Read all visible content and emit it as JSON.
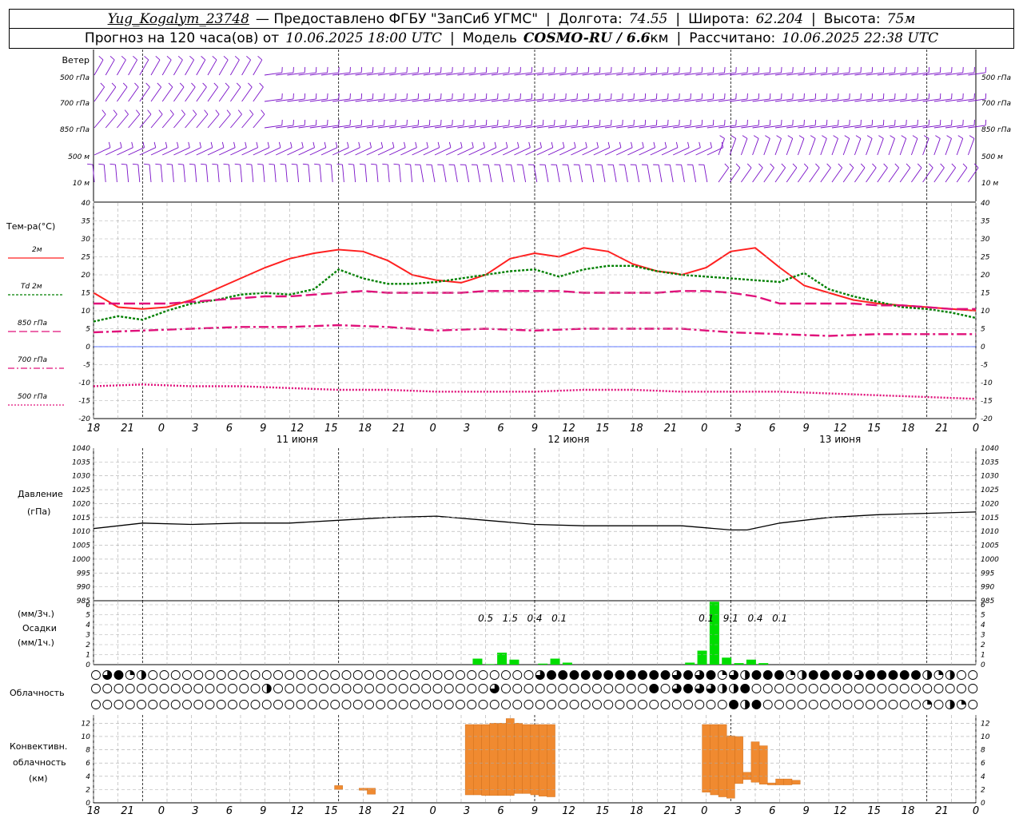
{
  "header": {
    "station": "Yug_Kogalym_23748",
    "provider": "— Предоставлено ФГБУ \"ЗапСиб УГМС\"",
    "lon_label": "Долгота:",
    "lon": "74.55",
    "lat_label": "Широта:",
    "lat": "62.204",
    "alt_label": "Высота:",
    "alt": "75м",
    "forecast_label": "Прогноз на 120 часа(ов) от",
    "forecast_from": "10.06.2025 18:00 UTC",
    "model_label": "Модель",
    "model": "COSMO-RU / 6.6",
    "model_unit": "км",
    "calc_label": "Рассчитано:",
    "calc_time": "10.06.2025 22:38 UTC"
  },
  "panels": {
    "wind": {
      "title": "Ветер",
      "levels": [
        "500 гПа",
        "700 гПа",
        "850 гПа",
        "500 м",
        "10 м"
      ]
    },
    "temp": {
      "title": "Тем-ра(°C)",
      "legend": [
        {
          "label": "2м",
          "color": "#ff2020"
        },
        {
          "label": "Td  2м",
          "color": "#008000"
        },
        {
          "label": "850 гПа",
          "color": "#e0107a"
        },
        {
          "label": "700 гПа",
          "color": "#e0107a"
        },
        {
          "label": "500 гПа",
          "color": "#e0107a"
        }
      ]
    },
    "pressure": {
      "title": "Давление",
      "unit": "(гПа)"
    },
    "precip": {
      "unit1": "(мм/3ч.)",
      "title": "Осадки",
      "unit2": "(мм/1ч.)"
    },
    "cloud": {
      "title": "Облачность"
    },
    "conv": {
      "title": "Конвективн.",
      "title2": "облачность",
      "unit": "(км)"
    }
  },
  "x_axis": {
    "tick_labels": [
      "18",
      "21",
      "0",
      "3",
      "6",
      "9",
      "12",
      "15",
      "18",
      "21",
      "0",
      "3",
      "6",
      "9",
      "12",
      "15",
      "18",
      "21",
      "0",
      "3",
      "6",
      "9",
      "12",
      "15",
      "18",
      "21",
      "0"
    ],
    "day_labels": [
      {
        "label": "11 июня",
        "hour": 18
      },
      {
        "label": "12 июня",
        "hour": 42
      },
      {
        "label": "13 июня",
        "hour": 66
      }
    ]
  },
  "chart_data": [
    {
      "type": "line",
      "title": "Тем-ра(°C)",
      "ylim": [
        -20,
        40
      ],
      "yticks": [
        -20,
        -15,
        -10,
        -5,
        0,
        5,
        10,
        15,
        20,
        25,
        30,
        35,
        40
      ],
      "series": [
        {
          "name": "2м",
          "x": [
            0,
            3,
            6,
            9,
            12,
            15,
            18,
            21,
            24,
            27,
            30,
            33,
            36,
            39,
            42,
            45,
            46,
            48,
            49,
            51,
            54,
            57,
            60,
            63,
            66,
            69,
            71,
            72,
            75,
            78,
            81,
            84,
            87,
            90,
            93,
            96,
            99,
            102,
            105,
            108
          ],
          "values": [
            15,
            11,
            10.5,
            11,
            13,
            16,
            19,
            22,
            24.5,
            26,
            27,
            26.5,
            24,
            20,
            18.5,
            17.8,
            18.5,
            20,
            21.5,
            24.5,
            26,
            25,
            27.5,
            26.5,
            23,
            21,
            20.5,
            20,
            22,
            26.5,
            27.5,
            22,
            17,
            15,
            13,
            12,
            11.5,
            11,
            10.5,
            10
          ]
        },
        {
          "name": "Td  2м",
          "x": [
            0,
            3,
            6,
            9,
            12,
            15,
            18,
            21,
            24,
            27,
            30,
            33,
            36,
            39,
            42,
            45,
            48,
            51,
            54,
            57,
            60,
            63,
            66,
            69,
            72,
            75,
            78,
            81,
            84,
            87,
            90,
            93,
            96,
            99,
            102,
            105,
            108
          ],
          "values": [
            7,
            8.5,
            7.5,
            10,
            12,
            13,
            14.5,
            15,
            14.5,
            16,
            21.5,
            19,
            17.5,
            17.5,
            18,
            19,
            20,
            21,
            21.5,
            19.5,
            21.5,
            22.5,
            22.5,
            21,
            20,
            19.5,
            19,
            18.5,
            18,
            20.5,
            16,
            14,
            12.5,
            11,
            10.5,
            9.5,
            8
          ]
        },
        {
          "name": "850 гПа",
          "x": [
            0,
            3,
            6,
            9,
            12,
            15,
            18,
            21,
            24,
            27,
            30,
            33,
            36,
            39,
            42,
            45,
            48,
            51,
            54,
            57,
            60,
            63,
            66,
            69,
            72,
            75,
            78,
            81,
            84,
            87,
            90,
            93,
            96,
            99,
            102,
            105,
            108
          ],
          "values": [
            12,
            12,
            12,
            12,
            12.5,
            13,
            13.5,
            14,
            14,
            14.5,
            15,
            15.5,
            15,
            15,
            15,
            15,
            15.5,
            15.5,
            15.5,
            15.5,
            15,
            15,
            15,
            15,
            15.5,
            15.5,
            15,
            14,
            12,
            12,
            12,
            12,
            11.5,
            11.5,
            11,
            10.5,
            10.5
          ]
        },
        {
          "name": "700 гПа",
          "x": [
            0,
            6,
            12,
            18,
            24,
            30,
            36,
            42,
            48,
            54,
            60,
            66,
            72,
            78,
            84,
            90,
            96,
            102,
            108
          ],
          "values": [
            4,
            4.5,
            5,
            5.5,
            5.5,
            6,
            5.5,
            4.5,
            5,
            4.5,
            5,
            5,
            5,
            4,
            3.5,
            3,
            3.5,
            3.5,
            3.5
          ]
        },
        {
          "name": "500 гПа",
          "x": [
            0,
            6,
            12,
            18,
            24,
            30,
            36,
            42,
            48,
            54,
            60,
            66,
            72,
            78,
            84,
            90,
            96,
            102,
            108
          ],
          "values": [
            -11,
            -10.5,
            -11,
            -11,
            -11.5,
            -12,
            -12,
            -12.5,
            -12.5,
            -12.5,
            -12,
            -12,
            -12.5,
            -12.5,
            -12.5,
            -13,
            -13.5,
            -14,
            -14.5
          ]
        }
      ]
    },
    {
      "type": "line",
      "title": "Давление",
      "ylabel": "(гПа)",
      "ylim": [
        985,
        1040
      ],
      "yticks": [
        985,
        990,
        995,
        1000,
        1005,
        1010,
        1015,
        1020,
        1025,
        1030,
        1035,
        1040
      ],
      "series": [
        {
          "name": "Давление",
          "x": [
            0,
            6,
            12,
            18,
            24,
            30,
            36,
            42,
            48,
            54,
            60,
            66,
            72,
            78,
            80,
            84,
            90,
            96,
            102,
            108
          ],
          "values": [
            1011,
            1013,
            1012.5,
            1013,
            1013,
            1014,
            1015,
            1015.5,
            1014,
            1012.5,
            1012,
            1012,
            1012,
            1010.5,
            1010.5,
            1013,
            1015,
            1016,
            1016.5,
            1017
          ]
        }
      ]
    },
    {
      "type": "bar",
      "title": "Осадки",
      "ylim": [
        0,
        6
      ],
      "yticks": [
        0,
        1,
        2,
        3,
        4,
        5,
        6
      ],
      "hours": [
        47,
        48.5,
        50,
        51.5,
        55,
        56.5,
        58,
        73,
        74.5,
        76,
        77.5,
        79,
        80.5,
        82
      ],
      "values": [
        0.6,
        0.05,
        1.2,
        0.5,
        0.1,
        0.6,
        0.2,
        0.2,
        1.4,
        6.3,
        0.7,
        0.15,
        0.5,
        0.15
      ],
      "labels_3h": [
        {
          "hour": 48,
          "text": "0.5"
        },
        {
          "hour": 51,
          "text": "1.5"
        },
        {
          "hour": 54,
          "text": "0.4"
        },
        {
          "hour": 57,
          "text": "0.1"
        },
        {
          "hour": 75,
          "text": "0.1"
        },
        {
          "hour": 78,
          "text": "9.1"
        },
        {
          "hour": 81,
          "text": "0.4"
        },
        {
          "hour": 84,
          "text": "0.1"
        }
      ]
    },
    {
      "type": "table",
      "title": "Облачность",
      "note": "cloud cover octas per hour, 3 layers (upper, middle, lower)",
      "rows": [
        "0,6,8,2,4,0,0,0,0,0,0,0,0,0,0,0,0,0,0,0,0,0,0,0,0,0,0,0,0,0,0,0,0,0,0,0,0,0,0,6,8,8,8,8,8,8,8,8,8,8,8,6,8,6,8,2,6,4,8,8,8,2,4,8,8,8,8,6,8,8,8,8,8,4,2,4,0,0,0,4,0,0,0,0,0,0,0,0,0,0,0,0,0,0,2,6,8,8,8,8,8,8,8,8,8,4,8,4,8,8,8,8,8,8,8,8,8,8,8,8,8",
        "0,0,0,0,0,0,0,0,0,0,0,0,0,0,0,4,0,0,0,0,0,0,0,0,0,0,0,0,0,0,0,0,0,0,0,6,0,0,0,0,0,0,0,0,0,0,0,0,0,8,0,6,8,6,6,4,4,8,0,0,0,0,0,0,0,0,0,0,0,0,0,0,0,0,0,0,0,0,0,0,0,0,0,0,0,0,0,0,0,0,0,8,0,0,0,8,8,8,8,8,8,8,4,8,4,8,8,8,8,8,8,8,8,8,8,8,8,8,8,8,8,8",
        "0,0,0,0,0,0,0,0,0,0,0,0,0,0,0,0,0,0,0,0,0,0,0,0,0,0,0,0,0,0,0,0,0,0,0,0,0,0,0,0,0,0,0,0,0,0,0,0,0,0,0,0,0,0,0,0,8,4,8,0,0,0,0,0,0,0,0,0,0,0,0,0,0,2,0,4,2,0,0,0,0,0,0,0,0,0,0,0,0,0,0,0,0,0,0,0,0,0,0,0,8,8,8,8,8,8,8,8,8,8,8,8,8,8,8,8,8,8,8,8,8,8,8,8,8"
      ]
    },
    {
      "type": "bar",
      "title": "Конвективн. облачность",
      "ylabel": "(км)",
      "ylim": [
        0,
        13
      ],
      "yticks": [
        0,
        2,
        4,
        6,
        8,
        10,
        12
      ],
      "bars": [
        {
          "x": 30,
          "w": 1,
          "bottom": 2.0,
          "top": 2.6
        },
        {
          "x": 33,
          "w": 1,
          "bottom": 1.9,
          "top": 2.2
        },
        {
          "x": 34,
          "w": 1,
          "bottom": 1.3,
          "top": 2.2
        },
        {
          "x": 46,
          "w": 1,
          "bottom": 1.2,
          "top": 11.8
        },
        {
          "x": 47,
          "w": 1,
          "bottom": 1.2,
          "top": 11.8
        },
        {
          "x": 48,
          "w": 1,
          "bottom": 1.1,
          "top": 11.8
        },
        {
          "x": 49,
          "w": 1,
          "bottom": 1.1,
          "top": 12
        },
        {
          "x": 50,
          "w": 1,
          "bottom": 1.1,
          "top": 12
        },
        {
          "x": 51,
          "w": 1,
          "bottom": 1.1,
          "top": 12.7
        },
        {
          "x": 52,
          "w": 1,
          "bottom": 1.4,
          "top": 12
        },
        {
          "x": 53,
          "w": 1,
          "bottom": 1.4,
          "top": 11.8
        },
        {
          "x": 54,
          "w": 1,
          "bottom": 1.2,
          "top": 11.8
        },
        {
          "x": 55,
          "w": 1,
          "bottom": 1.0,
          "top": 11.8
        },
        {
          "x": 56,
          "w": 1,
          "bottom": 0.9,
          "top": 11.8
        },
        {
          "x": 75,
          "w": 1,
          "bottom": 1.6,
          "top": 11.8
        },
        {
          "x": 76,
          "w": 1,
          "bottom": 1.2,
          "top": 11.8
        },
        {
          "x": 77,
          "w": 1,
          "bottom": 0.9,
          "top": 11.8
        },
        {
          "x": 78,
          "w": 1,
          "bottom": 0.7,
          "top": 10.1
        },
        {
          "x": 79,
          "w": 1,
          "bottom": 2.9,
          "top": 10
        },
        {
          "x": 80,
          "w": 1,
          "bottom": 3.5,
          "top": 4.6
        },
        {
          "x": 81,
          "w": 1,
          "bottom": 3.1,
          "top": 9.2
        },
        {
          "x": 82,
          "w": 1,
          "bottom": 2.8,
          "top": 8.6
        },
        {
          "x": 83,
          "w": 1,
          "bottom": 2.7,
          "top": 3.0
        },
        {
          "x": 84,
          "w": 1,
          "bottom": 2.7,
          "top": 3.6
        },
        {
          "x": 85,
          "w": 1,
          "bottom": 2.7,
          "top": 3.6
        },
        {
          "x": 86,
          "w": 1,
          "bottom": 2.8,
          "top": 3.4
        }
      ]
    }
  ]
}
